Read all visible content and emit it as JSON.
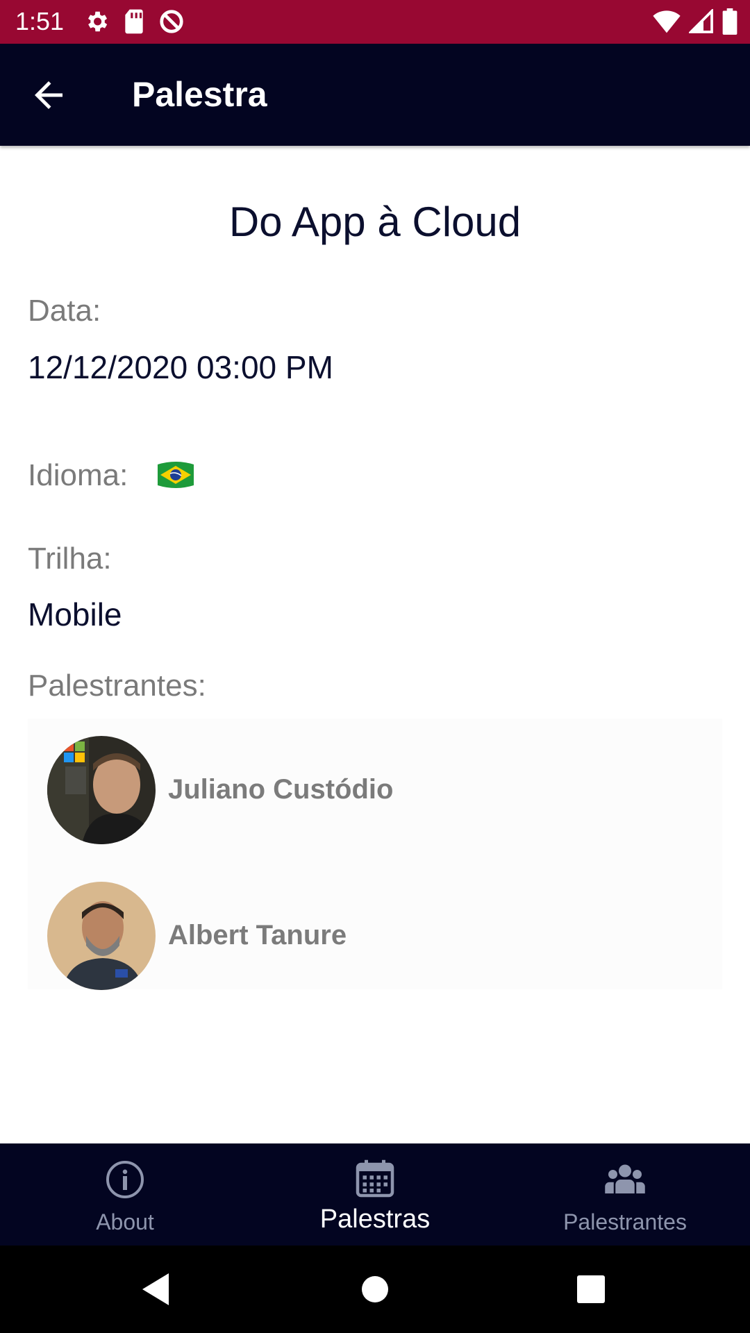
{
  "status_bar": {
    "time": "1:51",
    "color": "#980832",
    "left_icons": [
      "gear-icon",
      "sd-card-icon",
      "no-sync-icon"
    ],
    "right_icons": [
      "wifi-icon",
      "cell-signal-icon",
      "battery-icon"
    ]
  },
  "app_bar": {
    "title": "Palestra",
    "back_icon": "arrow-back-icon",
    "color": "#030521"
  },
  "talk": {
    "title": "Do App à Cloud",
    "date_label": "Data:",
    "date_value": "12/12/2020 03:00 PM",
    "language_label": "Idioma:",
    "language_icon": "brazil-flag-icon",
    "track_label": "Trilha:",
    "track_value": "Mobile",
    "speakers_label": "Palestrantes:"
  },
  "speakers": [
    {
      "name": "Juliano Custódio",
      "avatar": "speaker-photo"
    },
    {
      "name": "Albert Tanure",
      "avatar": "speaker-photo"
    }
  ],
  "bottom_nav": {
    "items": [
      {
        "label": "About",
        "icon": "info-icon",
        "active": false
      },
      {
        "label": "Palestras",
        "icon": "calendar-icon",
        "active": true
      },
      {
        "label": "Palestrantes",
        "icon": "people-icon",
        "active": false
      }
    ]
  },
  "system_nav": [
    "back-triangle-icon",
    "home-circle-icon",
    "recents-square-icon"
  ]
}
